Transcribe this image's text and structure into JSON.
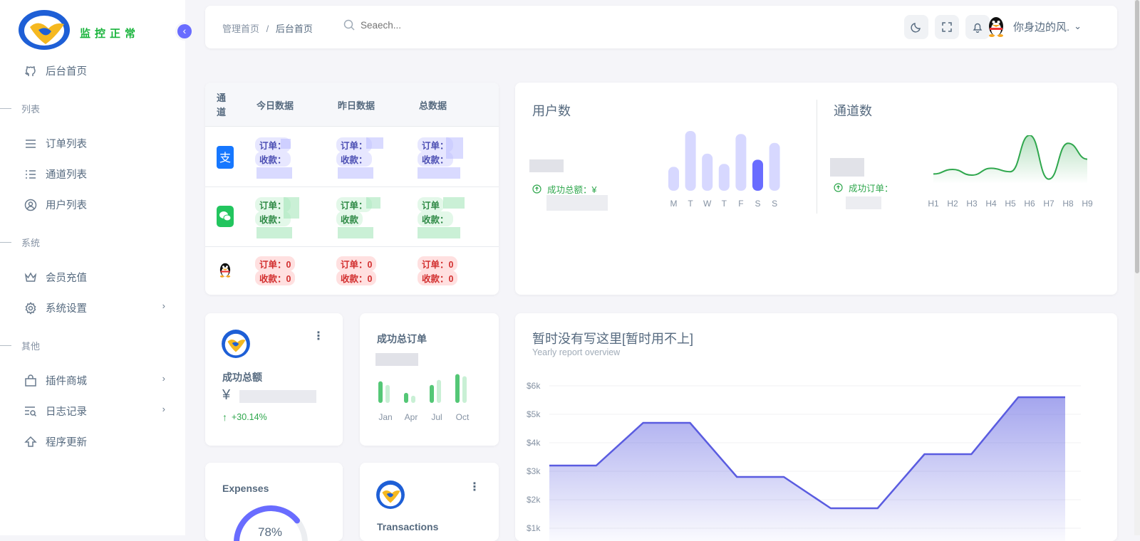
{
  "sidebar": {
    "brand": "监控正常",
    "items": [
      {
        "label": "后台首页"
      },
      {
        "section": "列表"
      },
      {
        "label": "订单列表"
      },
      {
        "label": "通道列表"
      },
      {
        "label": "用户列表"
      },
      {
        "section": "系统"
      },
      {
        "label": "会员充值"
      },
      {
        "label": "系统设置"
      },
      {
        "section": "其他"
      },
      {
        "label": "插件商城"
      },
      {
        "label": "日志记录"
      },
      {
        "label": "程序更新"
      }
    ]
  },
  "topbar": {
    "breadcrumb_root": "管理首页",
    "breadcrumb_sep": "/",
    "breadcrumb_current": "后台首页",
    "search_placeholder": "Seaech...",
    "username": "你身边的风."
  },
  "channel_table": {
    "headers": [
      "通道",
      "今日数据",
      "昨日数据",
      "总数据"
    ],
    "rows": [
      {
        "channel": "alipay-icon",
        "today": {
          "order": "订单：",
          "income": "收款："
        },
        "yesterday": {
          "order": "订单：",
          "income": "收款："
        },
        "total": {
          "order": "订单：",
          "income": "收款："
        }
      },
      {
        "channel": "wechat-icon",
        "today": {
          "order": "订单：",
          "income": "收款："
        },
        "yesterday": {
          "order": "订单：",
          "income": "收款"
        },
        "total": {
          "order": "订单",
          "income": "收款："
        }
      },
      {
        "channel": "qq-icon",
        "today": {
          "order": "订单：0",
          "income": "收款：0"
        },
        "yesterday": {
          "order": "订单：0",
          "income": "收款：0"
        },
        "total": {
          "order": "订单：0",
          "income": "收款：0"
        }
      }
    ]
  },
  "users_card": {
    "title": "用户数",
    "sub_label": "成功总额：¥",
    "chart_data": {
      "type": "bar",
      "categories": [
        "M",
        "T",
        "W",
        "T",
        "F",
        "S",
        "S"
      ],
      "values": [
        40,
        100,
        62,
        45,
        95,
        52,
        80
      ],
      "highlight_index": 5,
      "colors": {
        "bar": "#d7d8ff",
        "highlight": "#696cff"
      }
    }
  },
  "channels_card": {
    "title": "通道数",
    "sub_label": "成功订单：",
    "chart_data": {
      "type": "line",
      "categories": [
        "H1",
        "H2",
        "H3",
        "H4",
        "H5",
        "H6",
        "H7",
        "H8",
        "H9"
      ],
      "values": [
        12,
        20,
        10,
        22,
        16,
        80,
        3,
        66,
        38
      ],
      "color": "#2fa74d"
    }
  },
  "amount_card": {
    "title": "成功总额",
    "currency": "¥",
    "change": "+30.14%"
  },
  "orders_card": {
    "title": "成功总订单",
    "chart_data": {
      "type": "bar",
      "categories": [
        "Jan",
        "Apr",
        "Jul",
        "Oct"
      ],
      "series": [
        {
          "values": [
            60,
            28,
            50,
            80
          ]
        },
        {
          "values": [
            50,
            20,
            64,
            74
          ]
        }
      ],
      "colors": [
        "#54c776",
        "#c9f0d5"
      ]
    }
  },
  "expenses_card": {
    "title": "Expenses",
    "percent_text": "78%",
    "percent": 78
  },
  "transactions_card": {
    "title": "Transactions"
  },
  "report_card": {
    "title": "暂时没有写这里[暂时用不上]",
    "subtitle": "Yearly report overview",
    "chart_data": {
      "type": "area",
      "x": [
        0,
        1,
        2,
        3,
        4,
        5,
        6,
        7,
        8,
        9,
        10,
        11
      ],
      "values": [
        3.2,
        3.2,
        4.7,
        4.7,
        2.8,
        2.8,
        1.7,
        1.7,
        3.6,
        3.6,
        5.6,
        5.6
      ],
      "yticks": [
        "$6k",
        "$5k",
        "$4k",
        "$3k",
        "$2k",
        "$1k"
      ],
      "ylim": [
        1,
        6
      ],
      "color": "#5a5ce0"
    }
  }
}
